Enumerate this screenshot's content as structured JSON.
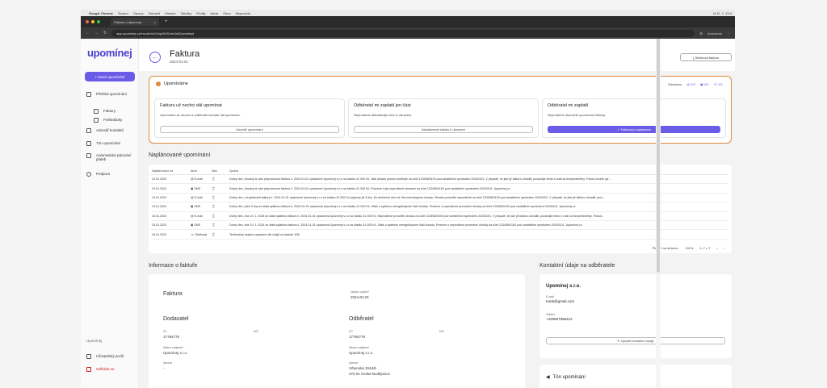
{
  "macbar": {
    "apple": "",
    "app": "Google Chrome",
    "menus": [
      "Soubor",
      "Úpravy",
      "Zobrazit",
      "Historie",
      "Záložky",
      "Profily",
      "Karta",
      "Okno",
      "Nápověda"
    ],
    "clock": "čt 11. 1. 13:4"
  },
  "browser": {
    "tab_title": "Faktura | Upomínej",
    "url": "app.upominej.cz/invoice/cl1r3qe3001mb3n62yzwdepd",
    "profile": "Anonymní"
  },
  "sidebar": {
    "logo": "upomínej",
    "new_button": "+  Nová upomínání",
    "items": [
      {
        "label": "Přehled upomínání"
      },
      {
        "label": "Faktury"
      },
      {
        "label": "Pohledávky"
      },
      {
        "label": "Adresář kontaktů"
      },
      {
        "label": "Tón upomínání"
      },
      {
        "label": "Automatické párování plateb"
      },
      {
        "label": "Podpora"
      }
    ],
    "footer": {
      "org": "Upomínej",
      "profile": "Uživatelský profil",
      "logout": "Odhlásit se"
    }
  },
  "header": {
    "title": "Faktura",
    "date": "2024-01-01",
    "download": "Stáhnout fakturu"
  },
  "reminders": {
    "title": "Upomínáme",
    "sent_label": "Odesláno",
    "email_count": "0/3",
    "sms_count": "0/3",
    "call_count": "0/1",
    "cards": [
      {
        "title": "Fakturu už nechci dál upomínat",
        "text": "Upomínání se ukončí a odběratel nebude dál upomínán.",
        "button": "Ukončit upomínání"
      },
      {
        "title": "Odběratel mi zaplatil jen část",
        "text": "Neprodleně aktualizujte cenu k uhrazení.",
        "button": "Aktualizovat částku k uhrazení"
      },
      {
        "title": "Odběratel mi zaplatil",
        "text": "Neprodleně ukončete upomínání faktury.",
        "button": "✓  Faktura je zaplacena"
      }
    ]
  },
  "schedule": {
    "title": "Naplánované upomínání",
    "columns": [
      "Naplánováno na",
      "Akce",
      "Stav",
      "Zpráva"
    ],
    "rows": [
      {
        "date": "10.01.2024",
        "action": "E-mail",
        "msg": "Dobrý den, dovoluji si vám připomenout fakturu č. 2024-01-01 vystavené Upomínej s.r.o na částku 41 000 Kč. Vaši úhradu prosím směřujte na účet 123456/0100 pod variabilním symbolem 20240101. V případě, že jste již fakturu uhradili, považujte tento e-mail za bezpředmětný. Pokud chcete vyř..."
      },
      {
        "date": "10.01.2024",
        "action": "SMS",
        "msg": "Dobrý den, dovoluji si vám připomenout fakturu č. 2024-01-01 vystavené Upomínej s.r.o na částku 41 000 Kč. Prosíme o její neprodlené uhrazení na účet 123456/0100 pod variabilním symbolem 20240101. Upomínej.cz"
      },
      {
        "date": "13.01.2024",
        "action": "E-mail",
        "msg": "Dobrý den, od splatnosti faktury č. 2024-01-01 vystavené Upomínej s.r.o na částku 41 000 Kč uplynuly již 3 dny. Do dnešního dne od Vás neevidujeme úhradu. Úhradu proveďte neprodleně na účet 123456/0100 pod variabilním symbolem 20240101. V případě, že jste již fakturu uhradili, prov..."
      },
      {
        "date": "13.01.2024",
        "action": "SMS",
        "msg": "Dobrý den, před 3 dny se stala splatnou faktura č. 2024-01-01 vystavená Upomínej s.r.o na částku 41 000 Kč. Stále u systému neregistrujeme Vaši úhradu. Prosíme o neprodlené provedení úhrady na účet 123456/0100 pod variabilním symbolem 20240101. Upomínej.cz"
      },
      {
        "date": "15.01.2024",
        "action": "E-mail",
        "msg": "Dobrý den, dne 10. 1. 2024 se stala splatnou faktura č. 2024-01-01 vystavená Upomínej s.r.o na částku 41 000 Kč. Neprodleně proveďte úhradu na účet 123456/0100 pod variabilním symbolem 20240101. V případě, že jste již fakturu uhradili, považujte tento e-mail za bezpředmětný. Pokud..."
      },
      {
        "date": "15.01.2024",
        "action": "SMS",
        "msg": "Dobrý den, dne 10. 1. 2024 se stala splatnou faktura č. 2024-01-01 vystavená Upomínej s.r.o na částku 41 000 Kč. Stále u systému neregistrujeme Vaši úhradu. Prosíme o neprodlené provedení úhrady na účet 123456/0100 pod variabilním symbolem 20240101. Upomínej.cz"
      },
      {
        "date": "16.01.2024",
        "action": "Telefonát",
        "msg": "Telefonický ústyk/e zaplacení dle údajů na faktuře 1/3b"
      }
    ],
    "rows_per_page_label": "Řádků na stránce:",
    "rows_per_page": "100",
    "range": "1–7 z 7"
  },
  "invoice_info": {
    "title": "Informace o faktuře",
    "name": "Faktura",
    "date_label": "Datum vydání*",
    "date": "2024-01-01",
    "supplier": {
      "title": "Dodavatel",
      "ico_label": "IČ*",
      "ico": "17784778",
      "dic_label": "DIČ",
      "name_label": "Název subjektu*",
      "name": "Upomínej s.r.o.",
      "address_label": "Adresa",
      "address": "-"
    },
    "customer": {
      "title": "Odběratel",
      "ico_label": "IČ*",
      "ico": "17784778",
      "dic_label": "DIČ",
      "name_label": "Název subjektu*",
      "name": "Upomínej s.r.o.",
      "address_label": "Adresa",
      "address": "Vrbenská 2044/6",
      "city": "370 01 České Budějovice"
    }
  },
  "contact": {
    "title": "Kontaktní údaje na odběratele",
    "company": "Upomínej s.r.o.",
    "email_label": "E-mail",
    "email": "turek@gmail.com",
    "phone_label": "Telefon",
    "phone": "+420607066412",
    "edit_button": "Upravit kontaktní údaje"
  },
  "tone": {
    "title": "Tón upomínání"
  },
  "colors": {
    "accent": "#6b5ce7",
    "highlight": "#e08a3c"
  }
}
